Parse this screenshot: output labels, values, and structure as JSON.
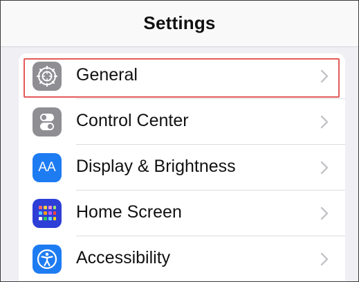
{
  "header": {
    "title": "Settings"
  },
  "settings": {
    "items": [
      {
        "label": "General",
        "icon": "gear-icon",
        "color": "#8e8e93"
      },
      {
        "label": "Control Center",
        "icon": "switches-icon",
        "color": "#8e8e93"
      },
      {
        "label": "Display & Brightness",
        "icon": "text-size-icon",
        "color": "#1e7cf2"
      },
      {
        "label": "Home Screen",
        "icon": "app-grid-icon",
        "color": "#2d3fd6"
      },
      {
        "label": "Accessibility",
        "icon": "accessibility-icon",
        "color": "#1e7cf2"
      }
    ],
    "highlighted_item": "General"
  },
  "icons": {
    "display_glyph": "AA"
  },
  "colors": {
    "highlight_border": "#e35a5a",
    "chevron": "#c4c4c8"
  }
}
